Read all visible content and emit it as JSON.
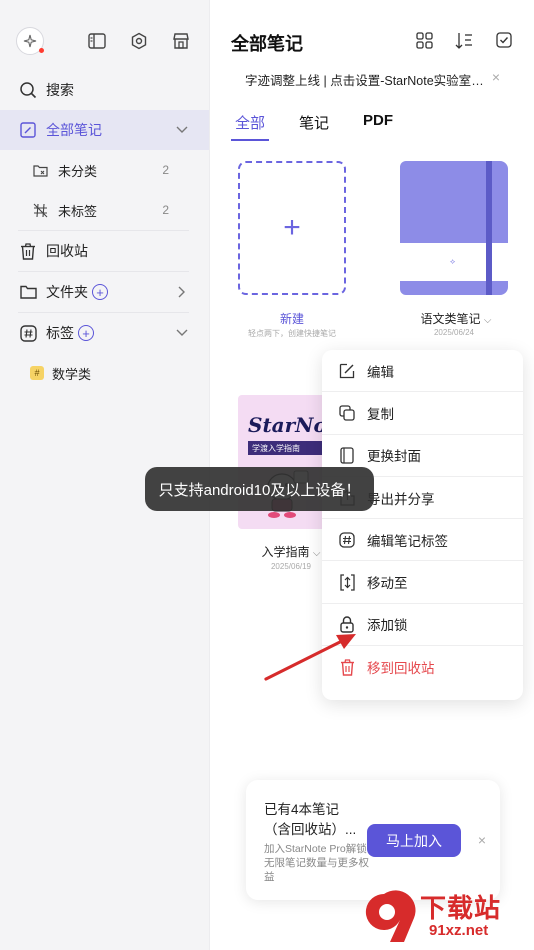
{
  "sidebar": {
    "items": [
      {
        "label": "搜索"
      },
      {
        "label": "全部笔记"
      },
      {
        "label": "未分类",
        "count": "2"
      },
      {
        "label": "未标签",
        "count": "2"
      },
      {
        "label": "回收站"
      },
      {
        "label": "文件夹"
      },
      {
        "label": "标签"
      },
      {
        "label": "数学类"
      }
    ]
  },
  "main": {
    "title": "全部笔记",
    "banner": "字迹调整上线 | 点击设置-StarNote实验室开...",
    "banner_close": "×",
    "tabs": [
      {
        "label": "全部"
      },
      {
        "label": "笔记"
      },
      {
        "label": "PDF"
      }
    ],
    "notes": [
      {
        "label": "新建",
        "sub": "轻点两下，创建快捷笔记"
      },
      {
        "label": "语文类笔记",
        "date": "2025/06/24"
      },
      {
        "label": "入学指南",
        "date": "2025/06/19"
      }
    ],
    "guide_cover": {
      "title": "StarNote",
      "subtitle": "学渡入学指南"
    }
  },
  "toast": "只支持android10及以上设备！",
  "menu": {
    "items": [
      {
        "label": "编辑"
      },
      {
        "label": "复制"
      },
      {
        "label": "更换封面"
      },
      {
        "label": "导出并分享"
      },
      {
        "label": "编辑笔记标签"
      },
      {
        "label": "移动至"
      },
      {
        "label": "添加锁"
      },
      {
        "label": "移到回收站"
      }
    ]
  },
  "promo": {
    "heading": "已有4本笔记（含回收站）...",
    "desc": "加入StarNote Pro解锁无限笔记数量与更多权益",
    "button": "马上加入",
    "close": "×"
  },
  "watermark": {
    "brand": "下载站",
    "domain": "91xz.net"
  },
  "colors": {
    "accent": "#5b55d8",
    "danger": "#e5484d",
    "arrow": "#d62b2b"
  }
}
